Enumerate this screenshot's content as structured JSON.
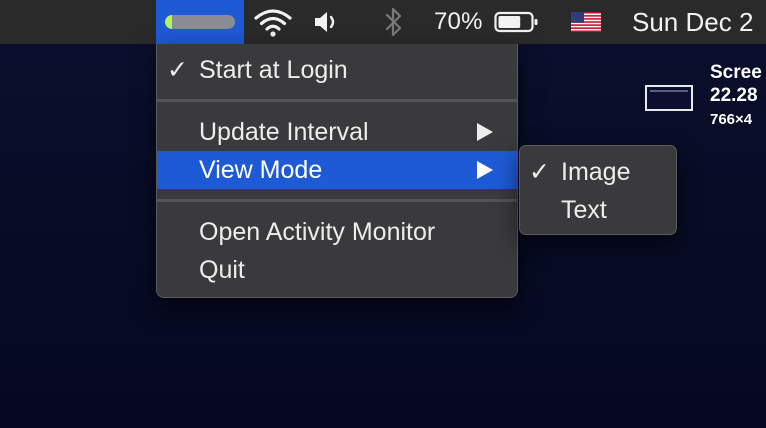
{
  "menubar": {
    "app_meter_level": 0.1,
    "app_meter_color": "#b6f25a",
    "app_highlight_color": "#1f5ad6",
    "wifi_icon": "wifi-icon",
    "volume_icon": "volume-icon",
    "bluetooth_icon": "bluetooth-icon",
    "battery_percent": "70%",
    "battery_level": 0.7,
    "input_source_icon": "us-flag-icon",
    "clock": "Sun Dec 2"
  },
  "menu": {
    "items": [
      {
        "label": "Start at Login",
        "checked": true,
        "submenu": false
      },
      {
        "label": "Update Interval",
        "checked": false,
        "submenu": true
      },
      {
        "label": "View Mode",
        "checked": false,
        "submenu": true,
        "highlighted": true
      },
      {
        "label": "Open Activity Monitor",
        "checked": false,
        "submenu": false
      },
      {
        "label": "Quit",
        "checked": false,
        "submenu": false
      }
    ],
    "check_glyph": "✓"
  },
  "submenu": {
    "items": [
      {
        "label": "Image",
        "checked": true
      },
      {
        "label": "Text",
        "checked": false
      }
    ]
  },
  "desktop_file": {
    "line1": "Scree",
    "line2": "22.28",
    "line3": "766×4"
  }
}
